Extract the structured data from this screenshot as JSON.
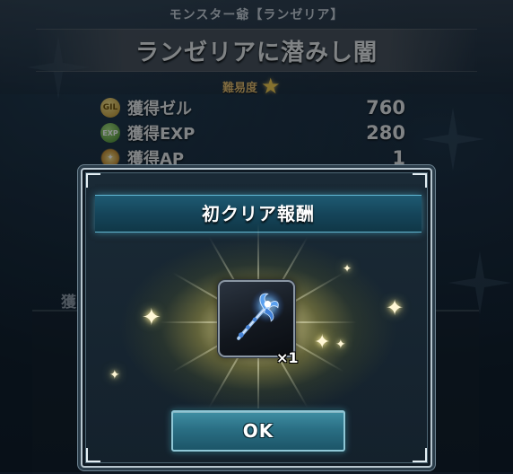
{
  "quest": {
    "monster_name": "モンスター爺【ランゼリア】",
    "title": "ランゼリアに潜みし闇",
    "difficulty_label": "難易度",
    "difficulty_stars": 1
  },
  "rewards": [
    {
      "icon": "gil-coin-icon",
      "icon_text": "GIL",
      "label": "獲得ゼル",
      "value": "760"
    },
    {
      "icon": "exp-icon",
      "icon_text": "EXP",
      "label": "獲得EXP",
      "value": "280"
    },
    {
      "icon": "ap-icon",
      "icon_text": "✦",
      "label": "獲得AP",
      "value": "1"
    }
  ],
  "background_panel": {
    "label": "獲"
  },
  "dialog": {
    "title": "初クリア報酬",
    "item": {
      "icon": "staff-weapon-icon",
      "quantity": "×1"
    },
    "ok_label": "OK"
  },
  "colors": {
    "dialog_header": "#1e5a72",
    "ok_button": "#2a6f84",
    "star": "#f1c64a",
    "glow": "#f5e896"
  }
}
